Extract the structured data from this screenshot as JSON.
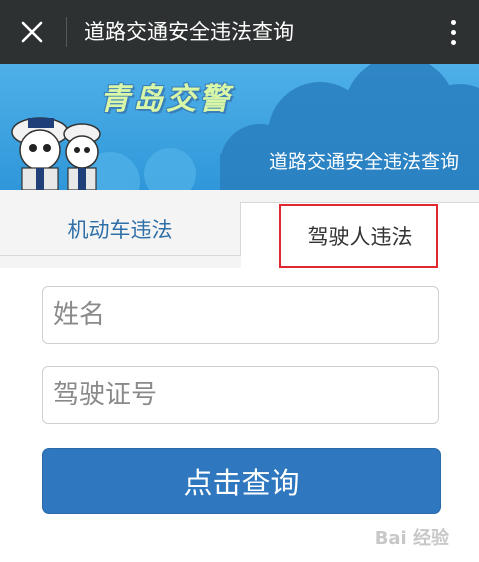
{
  "topbar": {
    "title": "道路交通安全违法查询",
    "close_icon": "close-icon",
    "more_icon": "more-vertical-icon"
  },
  "banner": {
    "brand_text": "青岛交警",
    "subtitle": "道路交通安全违法查询"
  },
  "tabs": [
    {
      "label": "机动车违法",
      "active": false
    },
    {
      "label": "驾驶人违法",
      "active": true
    }
  ],
  "form": {
    "name_placeholder": "姓名",
    "license_placeholder": "驾驶证号",
    "submit_label": "点击查询"
  },
  "watermark": "Bai 经验",
  "colors": {
    "topbar": "#2e3132",
    "banner": "#3aa2e0",
    "accent_blue": "#2f78bf",
    "tab_blue_text": "#2f6fa8",
    "highlight_red": "#e0282f"
  }
}
